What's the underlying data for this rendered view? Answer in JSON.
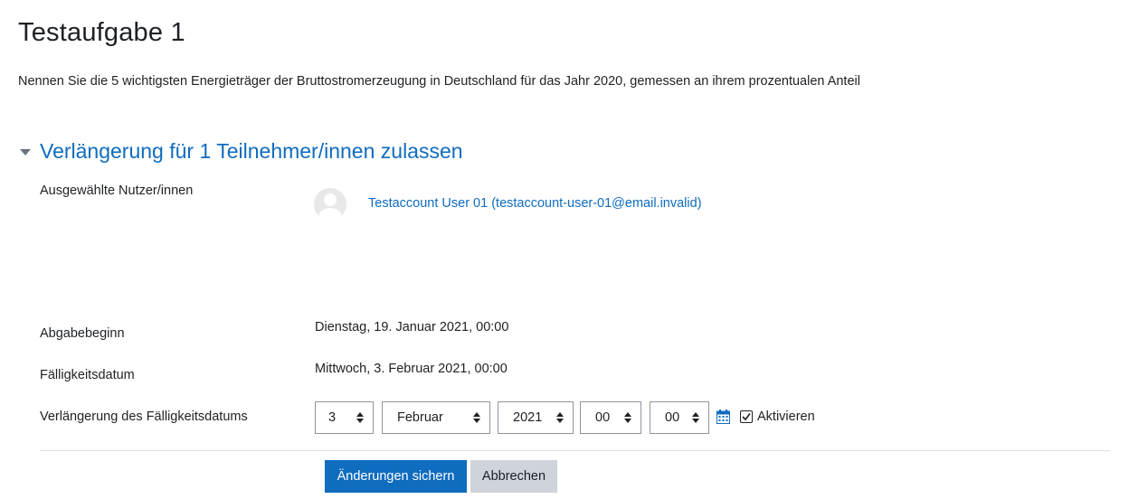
{
  "page": {
    "title": "Testaufgabe 1",
    "intro": "Nennen Sie die 5 wichtigsten Energieträger der Bruttostromerzeugung in Deutschland für das Jahr 2020, gemessen an ihrem prozentualen Anteil"
  },
  "section": {
    "title": "Verlängerung für 1 Teilnehmer/innen zulassen"
  },
  "form": {
    "selected_users_label": "Ausgewählte Nutzer/innen",
    "user_link": "Testaccount User 01 (testaccount-user-01@email.invalid)",
    "start_label": "Abgabebeginn",
    "start_value": "Dienstag, 19. Januar 2021, 00:00",
    "due_label": "Fälligkeitsdatum",
    "due_value": "Mittwoch, 3. Februar 2021, 00:00",
    "extension_label": "Verlängerung des Fälligkeitsdatums",
    "day": "3",
    "month": "Februar",
    "year": "2021",
    "hour": "00",
    "minute": "00",
    "enable_label": "Aktivieren",
    "enable_checked": true
  },
  "buttons": {
    "save": "Änderungen sichern",
    "cancel": "Abbrechen"
  },
  "colors": {
    "accent": "#0f6cbf",
    "secondary_button": "#ced4da",
    "divider": "#dee2e6"
  },
  "icons": {
    "section_toggle": "caret-down-icon",
    "select_arrows": "sort-arrows-icon",
    "calendar": "calendar-icon",
    "checkbox": "check-icon",
    "avatar": "default-user-icon"
  }
}
